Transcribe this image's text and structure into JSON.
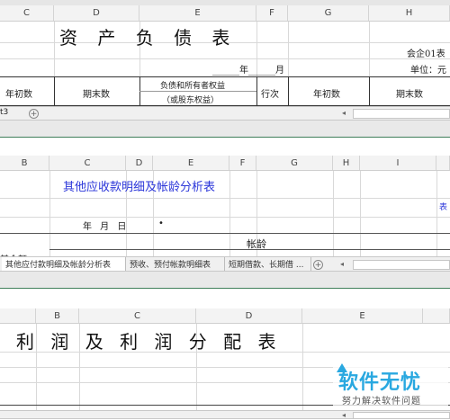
{
  "panel1": {
    "columns": [
      "C",
      "D",
      "E",
      "F",
      "G",
      "H"
    ],
    "title": "资 产 负 债 表",
    "form_code": "会企01表",
    "date_line": "______年______月",
    "unit": "单位：元",
    "headers": {
      "begin": "年初数",
      "end": "期末数",
      "liab_line1": "负债和所有者权益",
      "liab_line2": "（或股东权益）",
      "line_no": "行次",
      "begin2": "年初数",
      "end2": "期末数"
    },
    "sheet_tab_fragment": "t3"
  },
  "panel2": {
    "columns": [
      "B",
      "C",
      "D",
      "E",
      "F",
      "G",
      "H",
      "I"
    ],
    "title": "其他应收款明细及帐龄分析表",
    "side_label": "表",
    "date_row": "年  月  日",
    "dot": "•",
    "aging": "帐龄",
    "row_label": "其金额",
    "tabs": [
      "其他应付款明细及帐龄分析表",
      "预收、预付帐款明细表",
      "短期借款、长期借 ..."
    ]
  },
  "panel3": {
    "columns": [
      "B",
      "C",
      "D",
      "E"
    ],
    "title": "利 润 及 利 润 分 配 表"
  },
  "watermark": {
    "brand": "软件无忧",
    "tagline": "努力解决软件问题"
  }
}
